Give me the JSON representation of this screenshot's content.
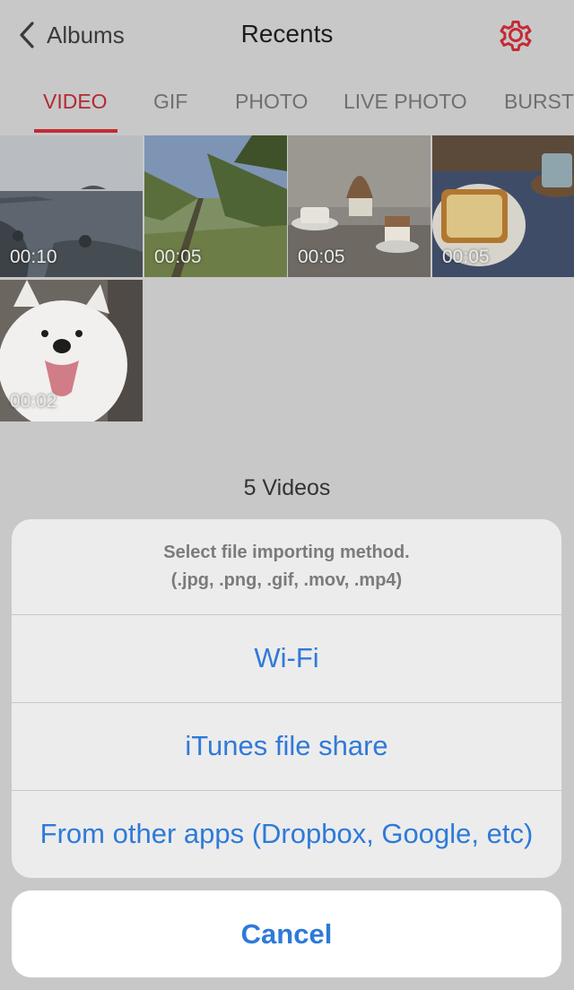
{
  "header": {
    "back_label": "Albums",
    "title": "Recents",
    "accent_color": "#c42a35"
  },
  "tabs": [
    {
      "label": "VIDEO",
      "active": true
    },
    {
      "label": "GIF",
      "active": false
    },
    {
      "label": "PHOTO",
      "active": false
    },
    {
      "label": "LIVE PHOTO",
      "active": false
    },
    {
      "label": "BURST",
      "active": false
    }
  ],
  "videos": [
    {
      "duration": "00:10",
      "subject": "sea coast"
    },
    {
      "duration": "00:05",
      "subject": "palm trees"
    },
    {
      "duration": "00:05",
      "subject": "cafe dessert"
    },
    {
      "duration": "00:05",
      "subject": "toast and coffee"
    },
    {
      "duration": "00:02",
      "subject": "white dog"
    }
  ],
  "count_label": "5 Videos",
  "action_sheet": {
    "message_line1": "Select file importing method.",
    "message_line2": "(.jpg, .png, .gif, .mov, .mp4)",
    "options": [
      {
        "label": "Wi-Fi"
      },
      {
        "label": "iTunes file share"
      },
      {
        "label": "From other apps (Dropbox, Google, etc)"
      }
    ],
    "cancel_label": "Cancel",
    "option_color": "#2e7ad9"
  },
  "icons": {
    "back": "chevron-left-icon",
    "settings": "gear-icon"
  }
}
